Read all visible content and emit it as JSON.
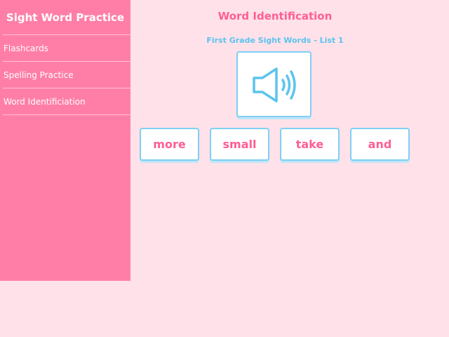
{
  "sidebar": {
    "title": "Sight Word Practice",
    "items": [
      {
        "label": "Flashcards"
      },
      {
        "label": "Spelling Practice"
      },
      {
        "label": "Word Identificiation"
      }
    ]
  },
  "main": {
    "title": "Word Identification",
    "subtitle": "First Grade Sight Words - List 1",
    "speaker_icon": "speaker-sound-icon",
    "words": [
      "more",
      "small",
      "take",
      "and"
    ]
  },
  "colors": {
    "background": "#ffe1ea",
    "sidebar": "#ff7ea8",
    "title_pink": "#ff5e95",
    "accent_blue": "#5bc4ee",
    "card_border": "#7fcff3"
  }
}
